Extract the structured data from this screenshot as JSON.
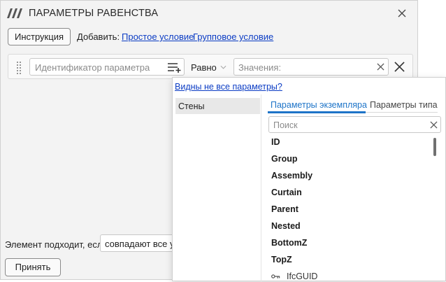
{
  "window": {
    "title": "ПАРАМЕТРЫ РАВЕНСТВА",
    "toolbar": {
      "instruction_label": "Инструкция",
      "add_label": "Добавить:",
      "simple_condition_link": "Простое условие",
      "group_condition_link": "Групповое условие"
    },
    "condition": {
      "param_placeholder": "Идентификатор параметра",
      "operator": "Равно",
      "values_placeholder": "Значения:"
    },
    "footer": {
      "match_label": "Элемент подходит, если",
      "match_value": "совпадают все усл",
      "accept_label": "Принять"
    }
  },
  "popup": {
    "not_all_link": "Видны не все параметры?",
    "categories": [
      "Стены"
    ],
    "tabs": [
      "Параметры экземпляра",
      "Параметры типа"
    ],
    "active_tab": 0,
    "search_placeholder": "Поиск",
    "params": [
      "ID",
      "Group",
      "Assembly",
      "Curtain",
      "Parent",
      "Nested",
      "BottomZ",
      "TopZ",
      "IfcGUID"
    ],
    "colors": {
      "accent": "#1e74c8",
      "link": "#0b3cc4"
    }
  }
}
